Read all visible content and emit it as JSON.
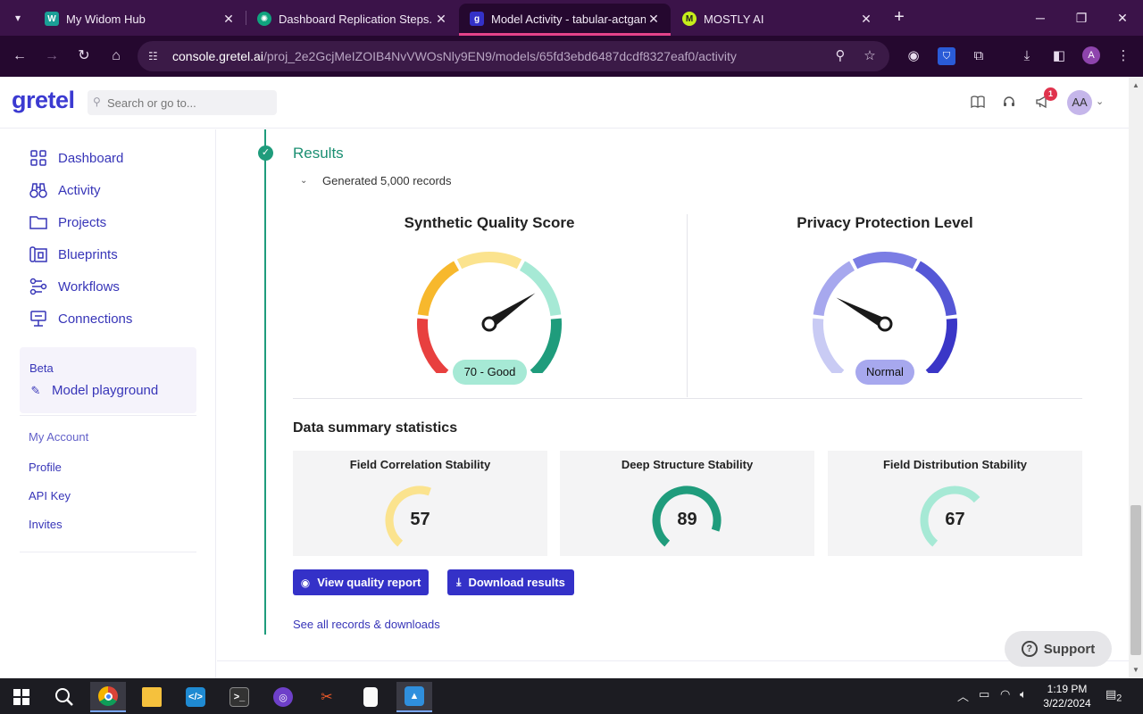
{
  "browser": {
    "tabs": [
      {
        "label": "My Widom Hub",
        "active": false,
        "favicon_color": "#1a9e96"
      },
      {
        "label": "Dashboard Replication Steps.",
        "active": false,
        "favicon_color": "#10a37f"
      },
      {
        "label": "Model Activity - tabular-actgan",
        "active": true,
        "favicon_color": "#3431c8"
      },
      {
        "label": "MOSTLY AI",
        "active": false,
        "favicon_color": "#c6ef1a"
      }
    ],
    "url_host": "console.gretel.ai",
    "url_path": "/proj_2e2GcjMeIZOIB4NvVWOsNly9EN9/models/65fd3ebd6487dcdf8327eaf0/activity",
    "profile_initial": "A"
  },
  "header": {
    "logo": "gretel",
    "search_placeholder": "Search or go to...",
    "notification_count": "1",
    "avatar_initials": "AA"
  },
  "sidebar": {
    "items": [
      {
        "label": "Dashboard",
        "icon": "grid-icon"
      },
      {
        "label": "Activity",
        "icon": "binoculars-icon"
      },
      {
        "label": "Projects",
        "icon": "folder-icon"
      },
      {
        "label": "Blueprints",
        "icon": "blueprint-icon"
      },
      {
        "label": "Workflows",
        "icon": "workflow-icon"
      },
      {
        "label": "Connections",
        "icon": "connection-icon"
      }
    ],
    "beta_label": "Beta",
    "playground_label": "Model playground",
    "account_title": "My Account",
    "account_links": [
      "Profile",
      "API Key",
      "Invites"
    ]
  },
  "main": {
    "results_title": "Results",
    "generated_text": "Generated 5,000 records",
    "quality": {
      "title": "Synthetic Quality Score",
      "score": 70,
      "badge": "70 - Good",
      "badge_color": "#a6e9d5"
    },
    "privacy": {
      "title": "Privacy Protection Level",
      "badge": "Normal",
      "badge_color": "#a7a8ee",
      "level": 0.28
    },
    "stats_title": "Data summary statistics",
    "stats": [
      {
        "title": "Field Correlation Stability",
        "value": "57",
        "score": 57,
        "color": "#fbe38e"
      },
      {
        "title": "Deep Structure Stability",
        "value": "89",
        "score": 89,
        "color": "#1f9c7c"
      },
      {
        "title": "Field Distribution Stability",
        "value": "67",
        "score": 67,
        "color": "#a6e9d5"
      }
    ],
    "view_report_label": "View quality report",
    "download_label": "Download results",
    "see_all_label": "See all records & downloads",
    "support_label": "Support"
  },
  "taskbar": {
    "time": "1:19 PM",
    "date": "3/22/2024",
    "notification_count": "2"
  }
}
